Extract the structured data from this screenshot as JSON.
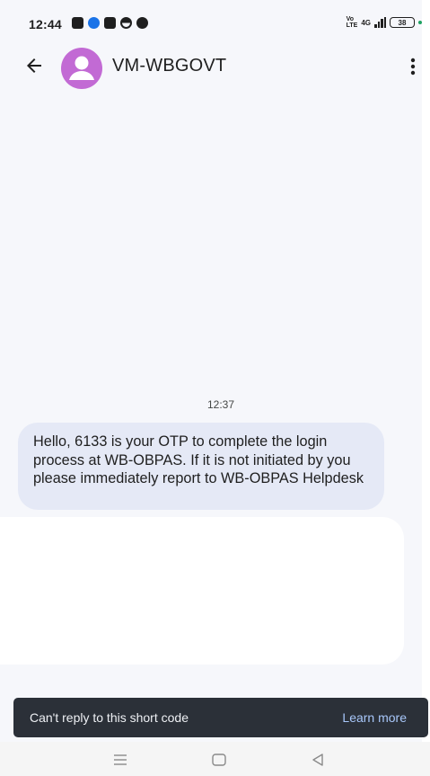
{
  "status_bar": {
    "time": "12:44",
    "battery": "38",
    "network": "4G"
  },
  "header": {
    "back_icon": "arrow-back-icon",
    "contact_name": "VM-WBGOVT",
    "menu_icon": "more-vert-icon",
    "avatar_color": "#c26ad4"
  },
  "conversation": {
    "timestamp": "12:37",
    "message": "Hello, 6133 is your OTP to complete the login process at WB-OBPAS. If it is not initiated by you please immediately report to WB-OBPAS Helpdesk"
  },
  "snackbar": {
    "text": "Can't reply to this short code",
    "action": "Learn more"
  },
  "nav": {
    "recents_icon": "recents-icon",
    "home_icon": "home-icon",
    "back_icon": "back-triangle-icon"
  },
  "colors": {
    "background": "#f6f7fb",
    "bubble": "#e5e9f6",
    "snackbar": "#2b3038",
    "snackbar_action": "#a8c7fa"
  }
}
